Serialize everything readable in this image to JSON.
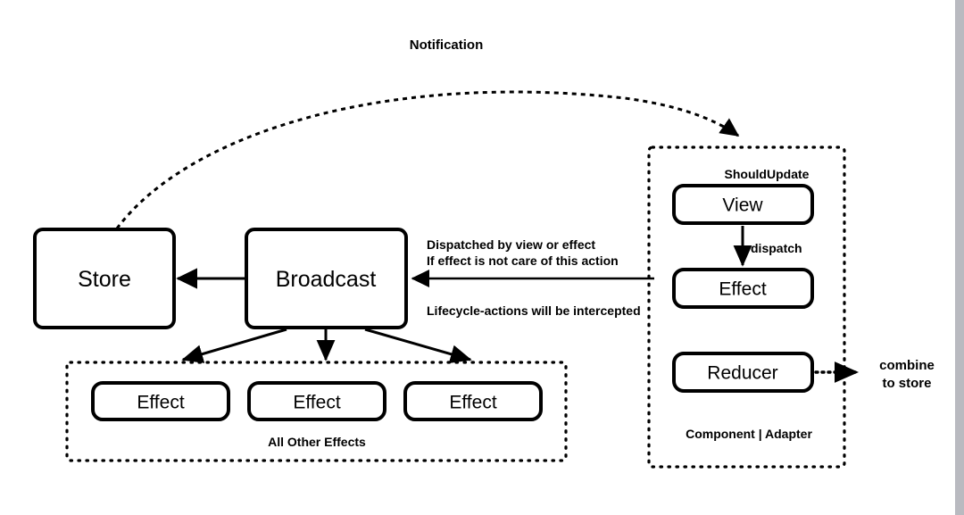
{
  "diagram": {
    "title_note": "Notification",
    "nodes": {
      "store": "Store",
      "broadcast": "Broadcast",
      "view": "View",
      "effect_right": "Effect",
      "reducer": "Reducer",
      "effect_1": "Effect",
      "effect_2": "Effect",
      "effect_3": "Effect"
    },
    "labels": {
      "should_update": "ShouldUpdate",
      "dispatch": "dispatch",
      "all_other_effects": "All Other Effects",
      "component_adapter": "Component | Adapter",
      "combine_line1": "combine",
      "combine_line2": "to store",
      "dispatched_line1": "Dispatched by view or effect",
      "dispatched_line2": "If effect is not care of this action",
      "lifecycle": "Lifecycle-actions will be intercepted"
    },
    "colors": {
      "stroke": "#000000",
      "background": "#ffffff",
      "gutter": "#b9bac0"
    }
  }
}
